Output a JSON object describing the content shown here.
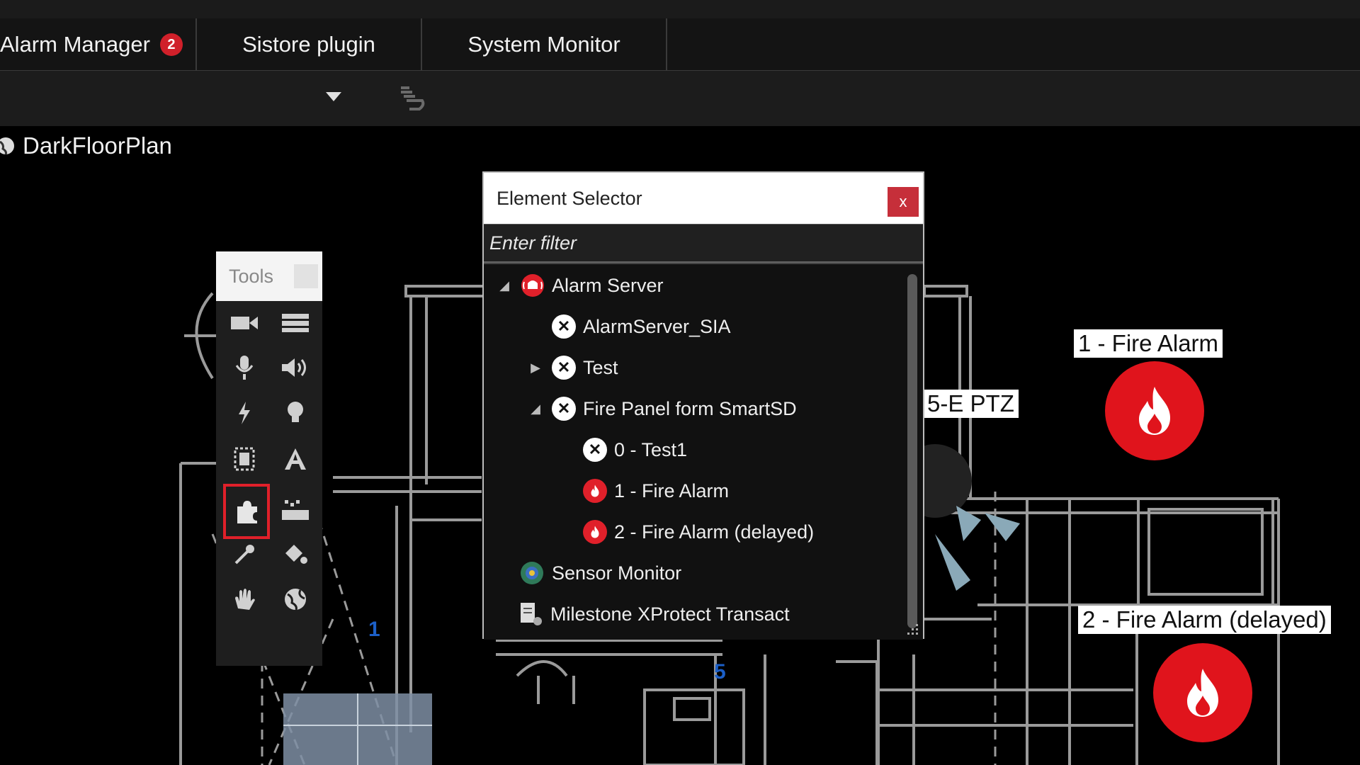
{
  "tabs": [
    {
      "label": "Alarm Manager",
      "badge": "2"
    },
    {
      "label": "Sistore plugin"
    },
    {
      "label": "System Monitor"
    }
  ],
  "breadcrumb": {
    "title": "DarkFloorPlan"
  },
  "tools": {
    "title": "Tools"
  },
  "selector": {
    "title": "Element Selector",
    "close": "x",
    "filter_placeholder": "Enter filter",
    "items": [
      {
        "label": "Alarm Server"
      },
      {
        "label": "AlarmServer_SIA"
      },
      {
        "label": "Test"
      },
      {
        "label": "Fire Panel form SmartSD"
      },
      {
        "label": "0 - Test1"
      },
      {
        "label": "1 - Fire Alarm"
      },
      {
        "label": "2 - Fire Alarm (delayed)"
      },
      {
        "label": "Sensor Monitor"
      },
      {
        "label": "Milestone XProtect Transact"
      }
    ]
  },
  "map": {
    "camera_label": "5-E PTZ",
    "alarm1_label": "1 - Fire Alarm",
    "alarm2_label": "2 - Fire Alarm (delayed)",
    "room1": "1",
    "room5": "5"
  },
  "colors": {
    "alarm_red": "#e0141c",
    "selected_outline": "#e0202a",
    "floor_lines": "#9a9a9a"
  }
}
